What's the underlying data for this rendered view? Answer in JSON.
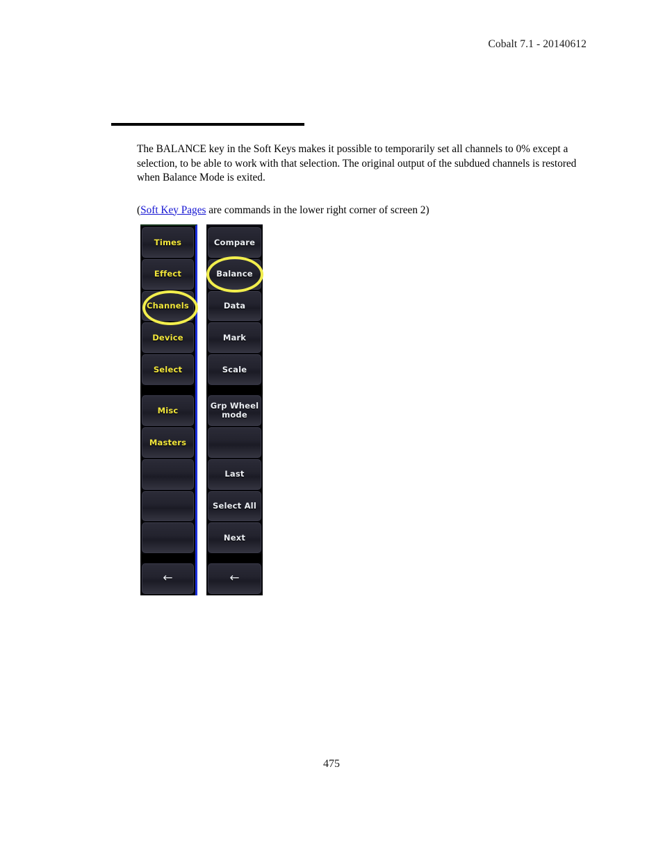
{
  "header": {
    "running_title": "Cobalt 7.1 - 20140612"
  },
  "body": {
    "paragraph_1": "The BALANCE key in the Soft Keys makes it possible to temporarily set all channels to 0% except a selection, to be able to work with that selection. The original output of the subdued channels is restored when Balance Mode is exited.",
    "paragraph_2_open": "(",
    "paragraph_2_link": "Soft Key Pages",
    "paragraph_2_rest": " are commands in the lower right corner of screen 2)"
  },
  "softkeys": {
    "left_column": [
      {
        "label": "Times",
        "type": "label"
      },
      {
        "label": "Effect",
        "type": "label"
      },
      {
        "label": "Channels",
        "type": "label"
      },
      {
        "label": "Device",
        "type": "label"
      },
      {
        "label": "Select",
        "type": "label"
      },
      {
        "label": "",
        "type": "separator"
      },
      {
        "label": "Misc",
        "type": "label"
      },
      {
        "label": "Masters",
        "type": "label"
      },
      {
        "label": "",
        "type": "empty"
      },
      {
        "label": "",
        "type": "empty"
      },
      {
        "label": "",
        "type": "empty"
      },
      {
        "label": "",
        "type": "separator"
      },
      {
        "label": "←",
        "type": "arrow"
      }
    ],
    "right_column": [
      {
        "label": "Compare",
        "type": "label"
      },
      {
        "label": "Balance",
        "type": "label"
      },
      {
        "label": "Data",
        "type": "label"
      },
      {
        "label": "Mark",
        "type": "label"
      },
      {
        "label": "Scale",
        "type": "label"
      },
      {
        "label": "",
        "type": "separator"
      },
      {
        "label": "Grp Wheel mode",
        "type": "label"
      },
      {
        "label": "",
        "type": "empty"
      },
      {
        "label": "Last",
        "type": "label"
      },
      {
        "label": "Select All",
        "type": "label"
      },
      {
        "label": "Next",
        "type": "label"
      },
      {
        "label": "",
        "type": "separator"
      },
      {
        "label": "←",
        "type": "arrow"
      }
    ],
    "highlights": [
      "Channels",
      "Balance"
    ],
    "colors": {
      "highlight": "#f2ee4d",
      "left_text": "#f2e63c",
      "right_text": "#eceff4",
      "panel_background": "#07070b",
      "edge_stripe": "#1a2fdc"
    }
  },
  "footer": {
    "page_number": "475"
  }
}
